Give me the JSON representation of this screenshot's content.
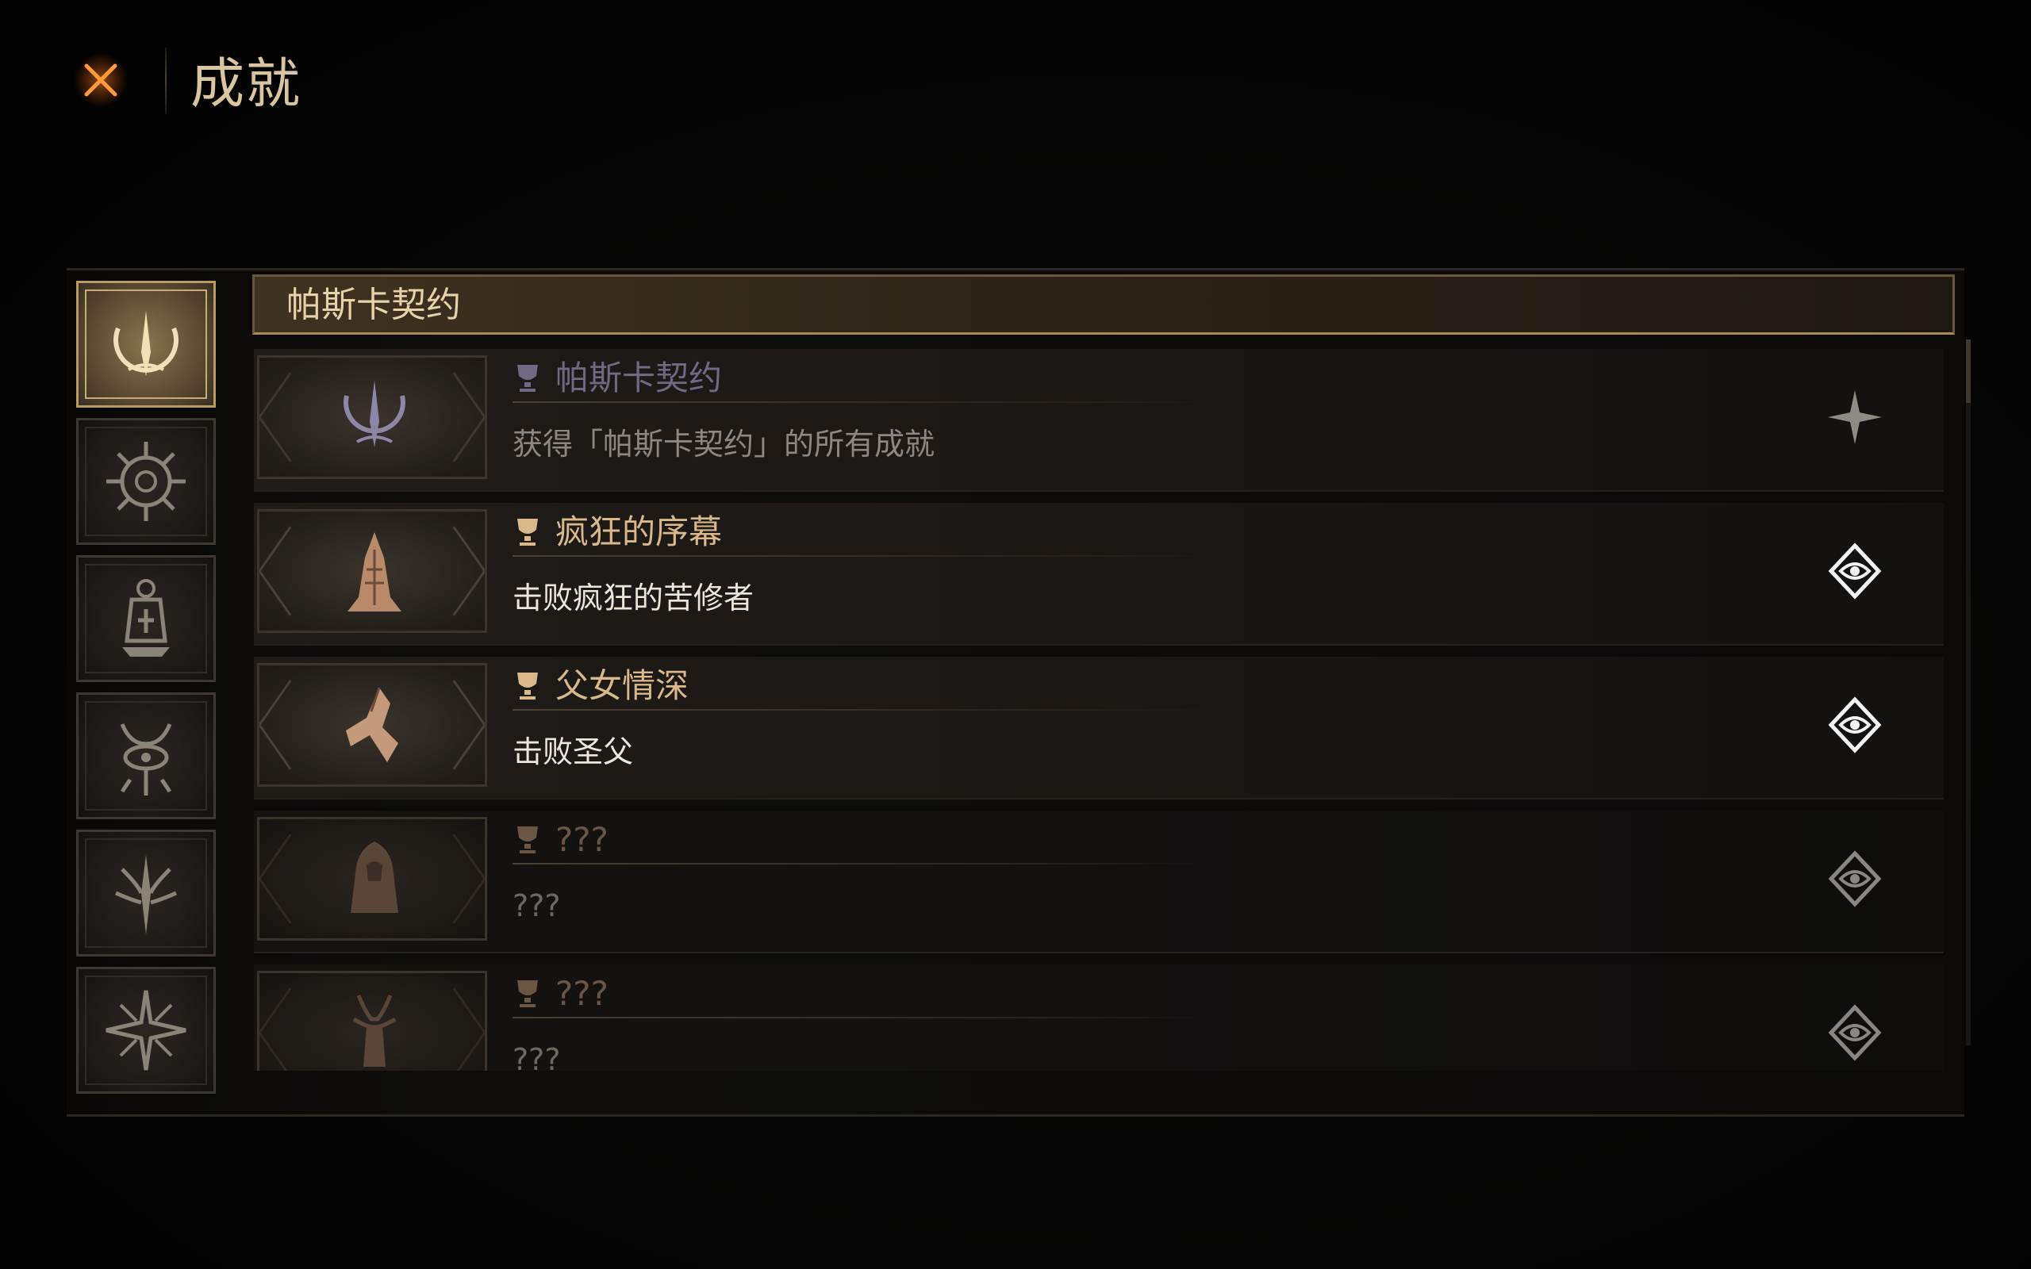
{
  "header": {
    "title": "成就"
  },
  "section": {
    "title": "帕斯卡契约"
  },
  "categories": [
    {
      "icon": "pact-sigil-icon",
      "active": true
    },
    {
      "icon": "compass-sun-icon",
      "active": false
    },
    {
      "icon": "lantern-icon",
      "active": false
    },
    {
      "icon": "horned-eye-icon",
      "active": false
    },
    {
      "icon": "tree-blade-icon",
      "active": false
    },
    {
      "icon": "thorn-star-icon",
      "active": false
    }
  ],
  "achievements": [
    {
      "title": "帕斯卡契约",
      "desc": "获得「帕斯卡契约」的所有成就",
      "state": "meta",
      "emblem": "pact-sigil-icon",
      "badge": "four-point-star-icon"
    },
    {
      "title": "疯狂的序幕",
      "desc": "击败疯狂的苦修者",
      "state": "unlocked",
      "emblem": "spire-icon",
      "badge": "eye-rune-icon"
    },
    {
      "title": "父女情深",
      "desc": "击败圣父",
      "state": "unlocked",
      "emblem": "winged-hand-icon",
      "badge": "eye-rune-icon"
    },
    {
      "title": "???",
      "desc": "???",
      "state": "locked",
      "emblem": "hooded-figure-icon",
      "badge": "eye-rune-icon"
    },
    {
      "title": "???",
      "desc": "???",
      "state": "locked",
      "emblem": "horned-beast-icon",
      "badge": "eye-rune-icon"
    }
  ],
  "colors": {
    "accent_gold": "#d9b88a",
    "title_cream": "#d9c6a0",
    "close_orange": "#ff7a1a"
  }
}
